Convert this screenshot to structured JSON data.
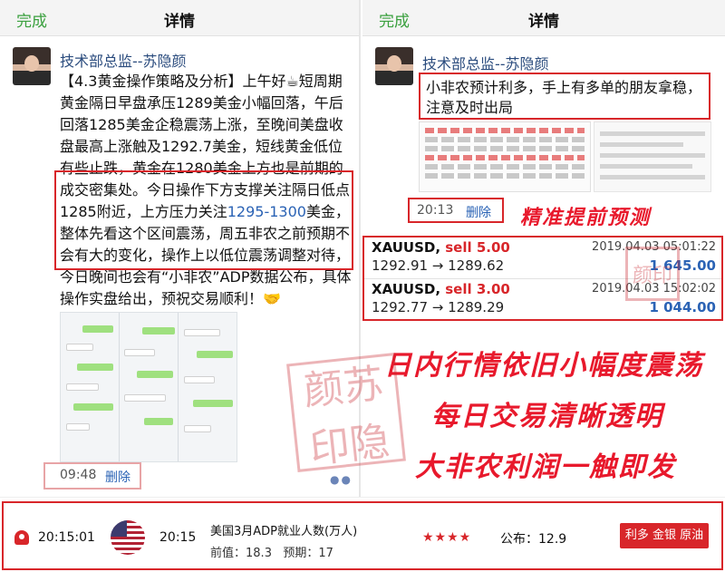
{
  "left_panel": {
    "done": "完成",
    "title": "详情",
    "author": "技术部总监--苏隐颜",
    "post": {
      "text_before_link": "【4.3黄金操作策略及分析】上午好☕短周期黄金隔日早盘承压1289美金小幅回落，午后回落1285美金企稳震荡上涨，至晚间美盘收盘最高上涨触及1292.7美金，短线黄金低位有些止跌，黄金在1280美金上方也是前期的成交密集处。今日操作下方支撑关注隔日低点1285附近，上方压力关注",
      "link": "1295-1300",
      "text_after_link": "美金，整体先看这个区间震荡，周五非农之前预期不会有大的变化，操作上以低位震荡调整对待，今日晚间也会有“小非农”ADP数据公布，具体操作实盘给出，预祝交易顺利！🤝"
    },
    "time": "09:48",
    "delete": "删除"
  },
  "right_panel": {
    "done": "完成",
    "title": "详情",
    "author": "技术部总监--苏隐颜",
    "notice": "小非农预计利多，手上有多单的朋友拿稳，注意及时出局",
    "time": "20:13",
    "delete": "删除",
    "slogan_top": "精准提前预测",
    "slogans": [
      "日内行情依旧小幅度震荡",
      "每日交易清晰透明",
      "大非农利润一触即发"
    ],
    "trades": [
      {
        "symbol": "XAUUSD",
        "side": "sell 5.00",
        "datetime": "2019.04.03 05:01:22",
        "prices": "1292.91 → 1289.62",
        "profit": "1 645.00"
      },
      {
        "symbol": "XAUUSD",
        "side": "sell 3.00",
        "datetime": "2019.04.03 15:02:02",
        "prices": "1292.77 → 1289.29",
        "profit": "1 044.00"
      }
    ]
  },
  "watermark": {
    "chars": [
      "颜",
      "苏",
      "印",
      "隐"
    ]
  },
  "event_bar": {
    "time_left": "20:15:01",
    "time_right": "20:15",
    "event_name": "美国3月ADP就业人数(万人)",
    "previous_label": "前值：",
    "previous_value": "18.3",
    "forecast_label": "预期：",
    "forecast_value": "17",
    "stars": "★★★★",
    "actual_label": "公布：",
    "actual_value": "12.9",
    "impact": "利多 金银 原油"
  },
  "colors": {
    "accent_red": "#d8262a",
    "link_blue": "#2b63b5",
    "done_green": "#3aa03e"
  }
}
